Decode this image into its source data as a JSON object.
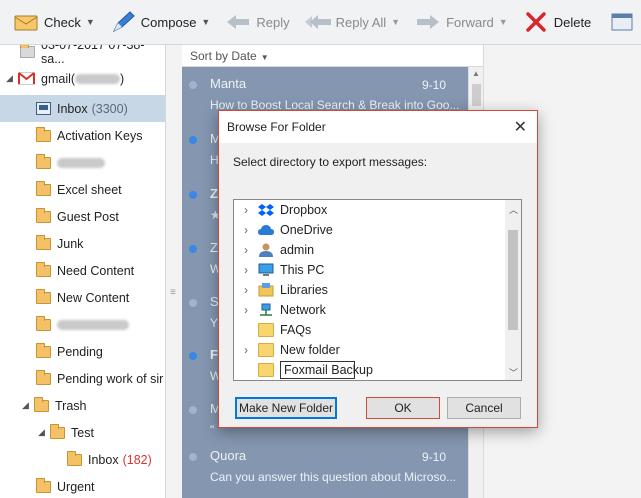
{
  "toolbar": {
    "check": "Check",
    "compose": "Compose",
    "reply": "Reply",
    "reply_all": "Reply All",
    "forward": "Forward",
    "delete": "Delete"
  },
  "sidebar": {
    "items": [
      {
        "label": "03-07-2017 07-38-sa..."
      },
      {
        "label": "gmail(",
        "blurred": true
      },
      {
        "label": "Inbox",
        "count": "(3300)"
      },
      {
        "label": "Activation Keys"
      },
      {
        "label": "",
        "blurred": true
      },
      {
        "label": "Excel sheet"
      },
      {
        "label": "Guest Post"
      },
      {
        "label": "Junk"
      },
      {
        "label": "Need Content"
      },
      {
        "label": "New Content"
      },
      {
        "label": "",
        "blurred": true
      },
      {
        "label": "Pending"
      },
      {
        "label": "Pending work of sir"
      },
      {
        "label": "Trash"
      },
      {
        "label": "Test"
      },
      {
        "label": "Inbox",
        "count": "(182)"
      },
      {
        "label": "Urgent"
      }
    ]
  },
  "message_list": {
    "sort_label": "Sort by Date",
    "messages": [
      {
        "from": "Manta",
        "time": "9-10",
        "subject": "How to Boost Local Search & Break into Goo..."
      },
      {
        "from": "M",
        "subject": "H"
      },
      {
        "from": "Z",
        "subject": ""
      },
      {
        "from": "Z",
        "subject": "W"
      },
      {
        "from": "S",
        "subject": "Y"
      },
      {
        "from": "F",
        "subject": "W"
      },
      {
        "from": "M",
        "subject": "\""
      },
      {
        "from": "Quora",
        "time": "9-10",
        "subject": "Can you answer this question about Microso..."
      }
    ]
  },
  "dialog": {
    "title": "Browse For Folder",
    "prompt": "Select directory to export messages:",
    "tree": [
      {
        "label": "Dropbox",
        "icon": "dropbox-icon"
      },
      {
        "label": "OneDrive",
        "icon": "cloud-icon"
      },
      {
        "label": "admin",
        "icon": "user-icon"
      },
      {
        "label": "This PC",
        "icon": "computer-icon"
      },
      {
        "label": "Libraries",
        "icon": "library-icon"
      },
      {
        "label": "Network",
        "icon": "network-icon"
      },
      {
        "label": "FAQs",
        "icon": "folder-icon"
      },
      {
        "label": "New folder",
        "icon": "folder-icon"
      },
      {
        "label": "Foxmail Backup",
        "icon": "folder-icon",
        "editing": true
      }
    ],
    "buttons": {
      "make_new_folder": "Make New Folder",
      "ok": "OK",
      "cancel": "Cancel"
    }
  },
  "colors": {
    "list_bg": "#8496b0",
    "selected_folder": "#c8d7e6",
    "dialog_border": "#d04a3c",
    "unread_dot": "#3b87e3"
  }
}
